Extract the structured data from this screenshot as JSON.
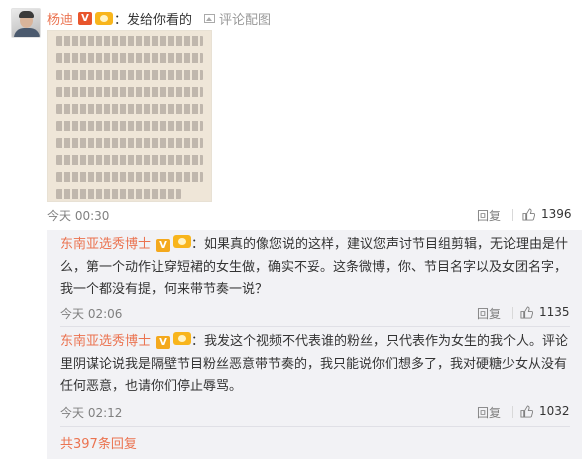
{
  "post": {
    "username": "杨迪",
    "v_badge": "V",
    "reply_text": "：发给你看的",
    "image_comment_label": "评论配图",
    "time": "今天 00:30",
    "reply_label": "回复",
    "like_count": "1396",
    "thumbnail_text_lines": [
      "游戏环节的目的就是出很难的动作来难倒对方，",
      "我跳的第一个动作，节目开始我就有提过，是沈",
      "梦辰在《乘风破浪的姐姐》里跳的女团舞的动",
      "作，我跳不到就觉得很难。但是谁知道有些说的",
      "那些恶心意味。后来我那个动作是非常尴尬，你",
      "仔细看节目内容都会儿其实能准确和张艺凡已经",
      "淘汰发生四顾了。为了突出效果才又剪辑出她们",
      "纷纷被我的动作难倒而喜欢，实际上群舍儿是表",
      "志已经跳了一个很基础的动作，我必须重出也是五",
      "才能难住他，完全是我和走出为了效果在battle。",
      "我的说解，你也用情的好用……"
    ]
  },
  "sub_comments": [
    {
      "username": "东南亚选秀博士",
      "v_badge": "V",
      "text": "：如果真的像您说的这样，建议您声讨节目组剪辑，无论理由是什么，第一个动作让穿短裙的女生做，确实不妥。这条微博，你、节目名字以及女团名字，我一个都没有提，何来带节奏一说？",
      "time": "今天 02:06",
      "reply_label": "回复",
      "like_count": "1135"
    },
    {
      "username": "东南亚选秀博士",
      "v_badge": "V",
      "text": "：我发这个视频不代表谁的粉丝，只代表作为女生的我个人。评论里阴谋论说我是隔壁节目粉丝恶意带节奏的，我只能说你们想多了，我对硬糖少女从没有任何恶意，也请你们停止辱骂。",
      "time": "今天 02:12",
      "reply_label": "回复",
      "like_count": "1032"
    }
  ],
  "total_replies_link": "共397条回复",
  "colors": {
    "accent": "#eb7350",
    "sub_background": "#f2f2f5",
    "meta_text": "#808080"
  }
}
